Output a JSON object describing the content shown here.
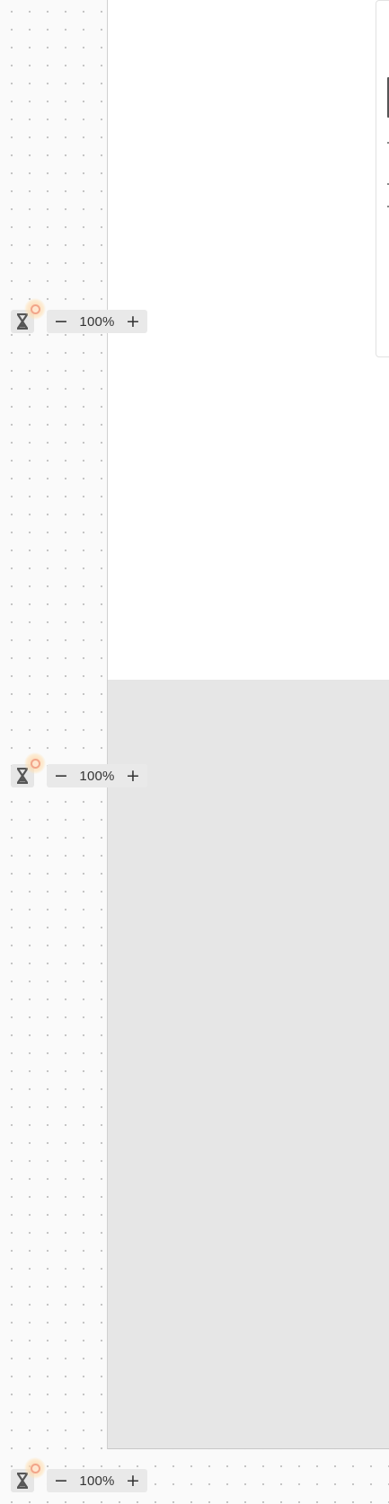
{
  "zoom_controls": [
    {
      "zoom_out_label": "−",
      "zoom_level": "100%",
      "zoom_in_label": "+"
    },
    {
      "zoom_out_label": "−",
      "zoom_level": "100%",
      "zoom_in_label": "+"
    },
    {
      "zoom_out_label": "−",
      "zoom_level": "100%",
      "zoom_in_label": "+"
    }
  ],
  "icons": {
    "timer": "hourglass-icon",
    "pulse": "pulse-indicator"
  },
  "colors": {
    "canvas_background": "#fafafa",
    "grid_dot": "#bdbdbd",
    "panel_white": "#ffffff",
    "panel_shaded": "#e6e6e6",
    "control_background": "#e9e9e9",
    "pulse_ring": "#f2a58a"
  }
}
